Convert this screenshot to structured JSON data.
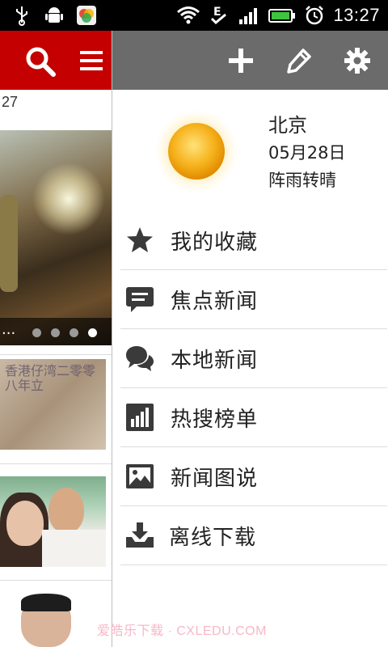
{
  "status_bar": {
    "time": "13:27",
    "icons": [
      "usb-icon",
      "android-debug-icon",
      "app-notification-icon",
      "wifi-icon",
      "data-icon",
      "signal-icon",
      "battery-icon",
      "alarm-icon"
    ]
  },
  "left_panel": {
    "date_fragment": "27",
    "slideshow": {
      "ellipsis": "...",
      "dot_count": 4,
      "active_dot": 3
    },
    "thumb_ink": "香港仔湾二零零八年立"
  },
  "drawer": {
    "toolbar": {
      "icons": [
        "add-icon",
        "edit-icon",
        "settings-icon"
      ]
    },
    "weather": {
      "city": "北京",
      "date": "05月28日",
      "condition": "阵雨转晴",
      "icon": "sun-icon"
    },
    "menu": [
      {
        "label": "我的收藏",
        "icon": "star-icon"
      },
      {
        "label": "焦点新闻",
        "icon": "message-icon"
      },
      {
        "label": "本地新闻",
        "icon": "chat-bubbles-icon"
      },
      {
        "label": "热搜榜单",
        "icon": "bar-chart-icon"
      },
      {
        "label": "新闻图说",
        "icon": "picture-icon"
      },
      {
        "label": "离线下载",
        "icon": "download-tray-icon"
      }
    ]
  },
  "watermark": "爱皓乐下载 · CXLEDU.COM",
  "colors": {
    "header_red": "#c40000",
    "toolbar_gray": "#6b6b6b",
    "icon_dark": "#3a3a3a"
  }
}
